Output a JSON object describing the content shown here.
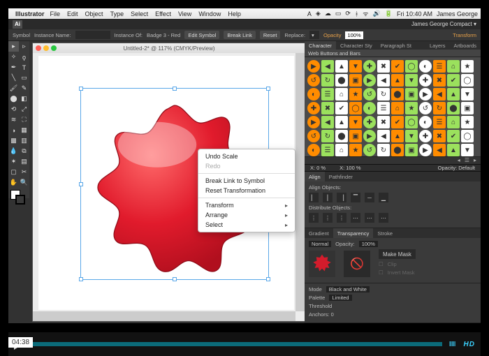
{
  "mac": {
    "app": "Illustrator",
    "menus": [
      "File",
      "Edit",
      "Object",
      "Type",
      "Select",
      "Effect",
      "View",
      "Window",
      "Help"
    ],
    "clock": "Fri 10:40 AM",
    "user": "James George"
  },
  "workspace": "James George Compact",
  "control_bar": {
    "label": "Symbol",
    "instance_name_label": "Instance Name:",
    "instance_of_label": "Instance Of:",
    "instance_of_value": "Badge 3 - Red",
    "buttons": {
      "edit": "Edit Symbol",
      "break": "Break Link",
      "reset": "Reset",
      "replace": "Replace:"
    },
    "opacity_label": "Opacity",
    "opacity_value": "100%",
    "transform": "Transform"
  },
  "doc": {
    "title": "Untitled-2* @ 117% (CMYK/Preview)"
  },
  "context_menu": {
    "undo": "Undo Scale",
    "redo": "Redo",
    "break": "Break Link to Symbol",
    "reset": "Reset Transformation",
    "transform": "Transform",
    "arrange": "Arrange",
    "select": "Select"
  },
  "panels": {
    "top_tabs": [
      "Character",
      "Character Sty",
      "Paragraph St",
      "",
      "Layers",
      "Artboards"
    ],
    "symbols_title": "Web Buttons and Bars",
    "coord": {
      "x": "X: 0 %",
      "x2": "X: 100 %"
    },
    "align": {
      "tabs": [
        "Align",
        "Pathfinder"
      ],
      "label1": "Align Objects:",
      "label2": "Distribute Objects:"
    },
    "gradient_tabs": [
      "Gradient",
      "Transparency",
      "Stroke"
    ],
    "transparency": {
      "mode": "Normal",
      "opacity_label": "Opacity:",
      "opacity_value": "100%",
      "make_mask": "Make Mask",
      "clip": "Clip",
      "invert": "Invert Mask"
    },
    "opacity_panel": "Opacity: Default",
    "trace": {
      "mode_label": "Mode",
      "mode_value": "Black and White",
      "palette_label": "Palette",
      "palette_value": "Limited",
      "threshold_label": "Threshold"
    },
    "anchors": "Anchors: 0"
  },
  "video": {
    "time": "04:38",
    "hd": "HD"
  }
}
